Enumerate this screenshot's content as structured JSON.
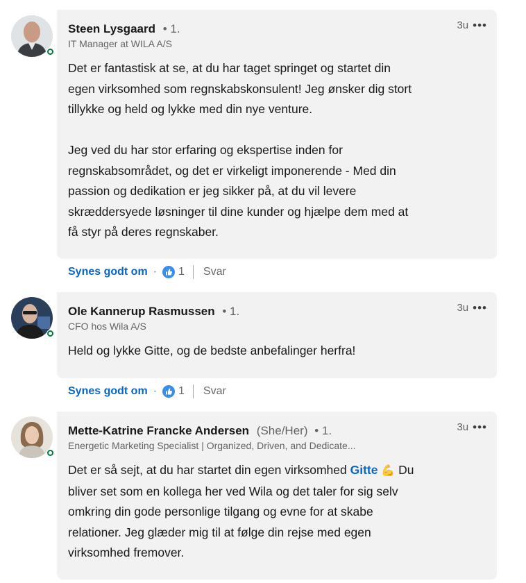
{
  "colors": {
    "accent": "#0a66c2",
    "bubble": "#f2f2f2",
    "online": "#057642"
  },
  "comments": [
    {
      "name": "Steen Lysgaard",
      "pronoun": "",
      "degree": "• 1.",
      "headline": "IT Manager at WILA A/S",
      "time": "3u",
      "more": "•••",
      "text": "Det er fantastisk at se, at du har taget springet og startet din\negen virksomhed som regnskabskonsulent! Jeg ønsker dig stort\ntillykke og held og lykke med din nye venture.\n\nJeg ved du har stor erfaring og ekspertise inden for\nregnskabsområdet, og det er virkeligt imponerende - Med din\npassion og dedikation er jeg sikker på, at du vil levere\nskræddersyede løsninger til dine kunder og hjælpe dem med at\nfå styr på deres regnskaber.",
      "like_label": "Synes godt om",
      "like_count": "1",
      "reply_label": "Svar"
    },
    {
      "name": "Ole Kannerup Rasmussen",
      "pronoun": "",
      "degree": "• 1.",
      "headline": "CFO hos Wila A/S",
      "time": "3u",
      "more": "•••",
      "text": "Held og lykke Gitte, og de bedste anbefalinger herfra!",
      "like_label": "Synes godt om",
      "like_count": "1",
      "reply_label": "Svar"
    },
    {
      "name": "Mette-Katrine Francke Andersen",
      "pronoun": "(She/Her)",
      "degree": "• 1.",
      "headline": "Energetic Marketing Specialist | Organized, Driven, and Dedicate...",
      "time": "3u",
      "more": "•••",
      "text_before": "Det er så sejt, at du har startet din egen virksomhed ",
      "mention": "Gitte",
      "emoji": "💪",
      "text_after": " Du\nbliver set som en kollega her ved Wila og det taler for sig selv\nomkring din gode personlige tilgang og evne for at skabe\nrelationer. Jeg glæder mig til at følge din rejse med egen\nvirksomhed fremover."
    }
  ]
}
